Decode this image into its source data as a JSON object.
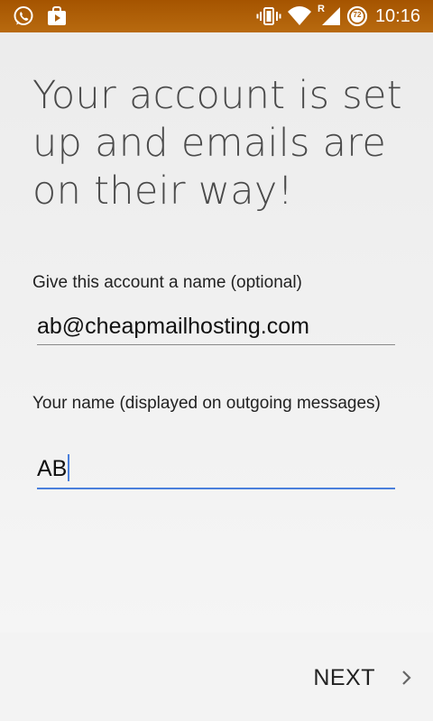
{
  "status_bar": {
    "time": "10:16",
    "battery_level": "72",
    "roaming_indicator": "R",
    "icons": [
      "whatsapp-icon",
      "briefcase-icon",
      "vibrate-icon",
      "wifi-icon",
      "cell-signal-icon",
      "battery-icon"
    ]
  },
  "page": {
    "headline": "Your account is set up and emails are on their way!"
  },
  "form": {
    "account_name": {
      "label": "Give this account a name (optional)",
      "value": "ab@cheapmailhosting.com"
    },
    "your_name": {
      "label": "Your name (displayed on outgoing messages)",
      "value": "AB"
    }
  },
  "footer": {
    "next_label": "NEXT",
    "next_icon": "chevron-right-icon"
  },
  "colors": {
    "status_bar": "#a55400",
    "focus_accent": "#4a7fdc",
    "text_primary": "#222222",
    "headline": "#4a4a4a"
  }
}
